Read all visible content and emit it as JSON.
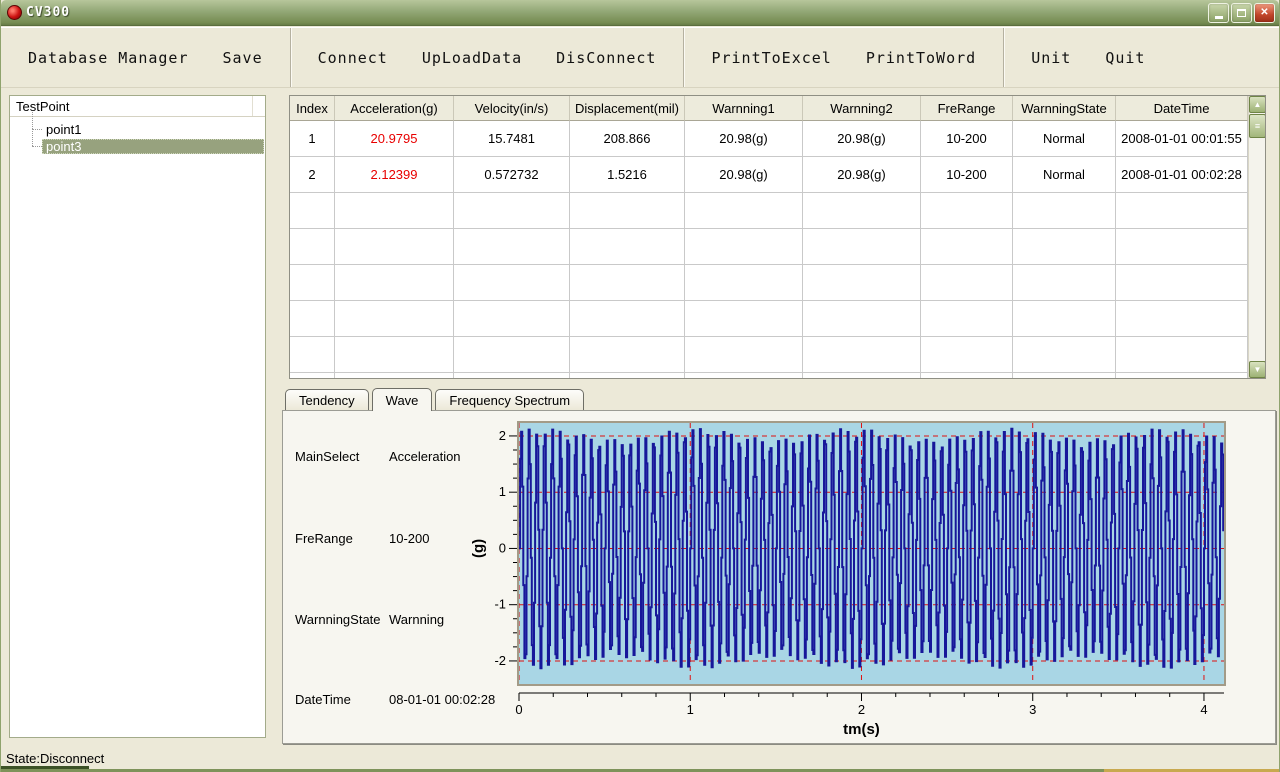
{
  "window": {
    "title": "CV300"
  },
  "titlebar": {
    "controls": [
      {
        "name": "minimize-button",
        "kind": "min"
      },
      {
        "name": "maximize-button",
        "kind": "max"
      },
      {
        "name": "close-button",
        "kind": "close",
        "glyph": "✕"
      }
    ]
  },
  "toolbar": {
    "groups": [
      [
        "Database Manager",
        "Save"
      ],
      [
        "Connect",
        "UpLoadData",
        "DisConnect"
      ],
      [
        "PrintToExcel",
        "PrintToWord"
      ],
      [
        "Unit",
        "Quit"
      ]
    ]
  },
  "sidebar": {
    "title": "TestPoint",
    "items": [
      {
        "label": "point1",
        "selected": false
      },
      {
        "label": "point3",
        "selected": true
      }
    ]
  },
  "table": {
    "columns": [
      "Index",
      "Acceleration(g)",
      "Velocity(in/s)",
      "Displacement(mil)",
      "Warnning1",
      "Warnning2",
      "FreRange",
      "WarnningState",
      "DateTime"
    ],
    "rows": [
      [
        "1",
        "20.9795",
        "15.7481",
        "208.866",
        "20.98(g)",
        "20.98(g)",
        "10-200",
        "Normal",
        "2008-01-01 00:01:55"
      ],
      [
        "2",
        "2.12399",
        "0.572732",
        "1.5216",
        "20.98(g)",
        "20.98(g)",
        "10-200",
        "Normal",
        "2008-01-01 00:02:28"
      ]
    ],
    "empty_rows": 6,
    "accel_column_index": 1,
    "accel_color": "#e80000"
  },
  "tabs": {
    "items": [
      "Tendency",
      "Wave",
      "Frequency Spectrum"
    ],
    "active_index": 1
  },
  "info": {
    "rows": [
      {
        "label": "MainSelect",
        "value": "Acceleration"
      },
      {
        "label": "FreRange",
        "value": "10-200"
      },
      {
        "label": "WarnningState",
        "value": "Warnning"
      },
      {
        "label": "DateTime",
        "value": "08-01-01 00:02:28"
      }
    ]
  },
  "chart_data": {
    "type": "line",
    "title": "",
    "xlabel": "tm(s)",
    "ylabel": "(g)",
    "xlim": [
      0,
      4.117
    ],
    "ylim": [
      -2.41,
      2.23
    ],
    "x_major_ticks": [
      0,
      1,
      2,
      3,
      4
    ],
    "x_minor_step": 0.2,
    "y_major_ticks": [
      -2,
      -1,
      0,
      1,
      2
    ],
    "y_minor_step": 0.25,
    "grid": {
      "style": "dashed",
      "color": "#e01010",
      "x_lines": [
        0,
        1,
        2,
        3,
        4
      ],
      "y_lines": [
        -2,
        -1,
        0,
        1,
        2
      ]
    },
    "plot_bg": "#a9d6e5",
    "plot_border": "#a39b87",
    "line_color": "#17179a",
    "signal": {
      "type": "am_sine",
      "description": "dense amplitude-modulated vibration waveform, ~90 oscillations over 4.1 s, peaks ±2.15 g",
      "carrier_hz": 22,
      "sample_rate_hz": 160,
      "base_amplitude": 2.03,
      "am_depth": 0.1,
      "am_hz": 1.1,
      "duration_s": 4.117,
      "render": "sample-hold"
    }
  },
  "statusbar": {
    "text": "State:Disconnect"
  }
}
